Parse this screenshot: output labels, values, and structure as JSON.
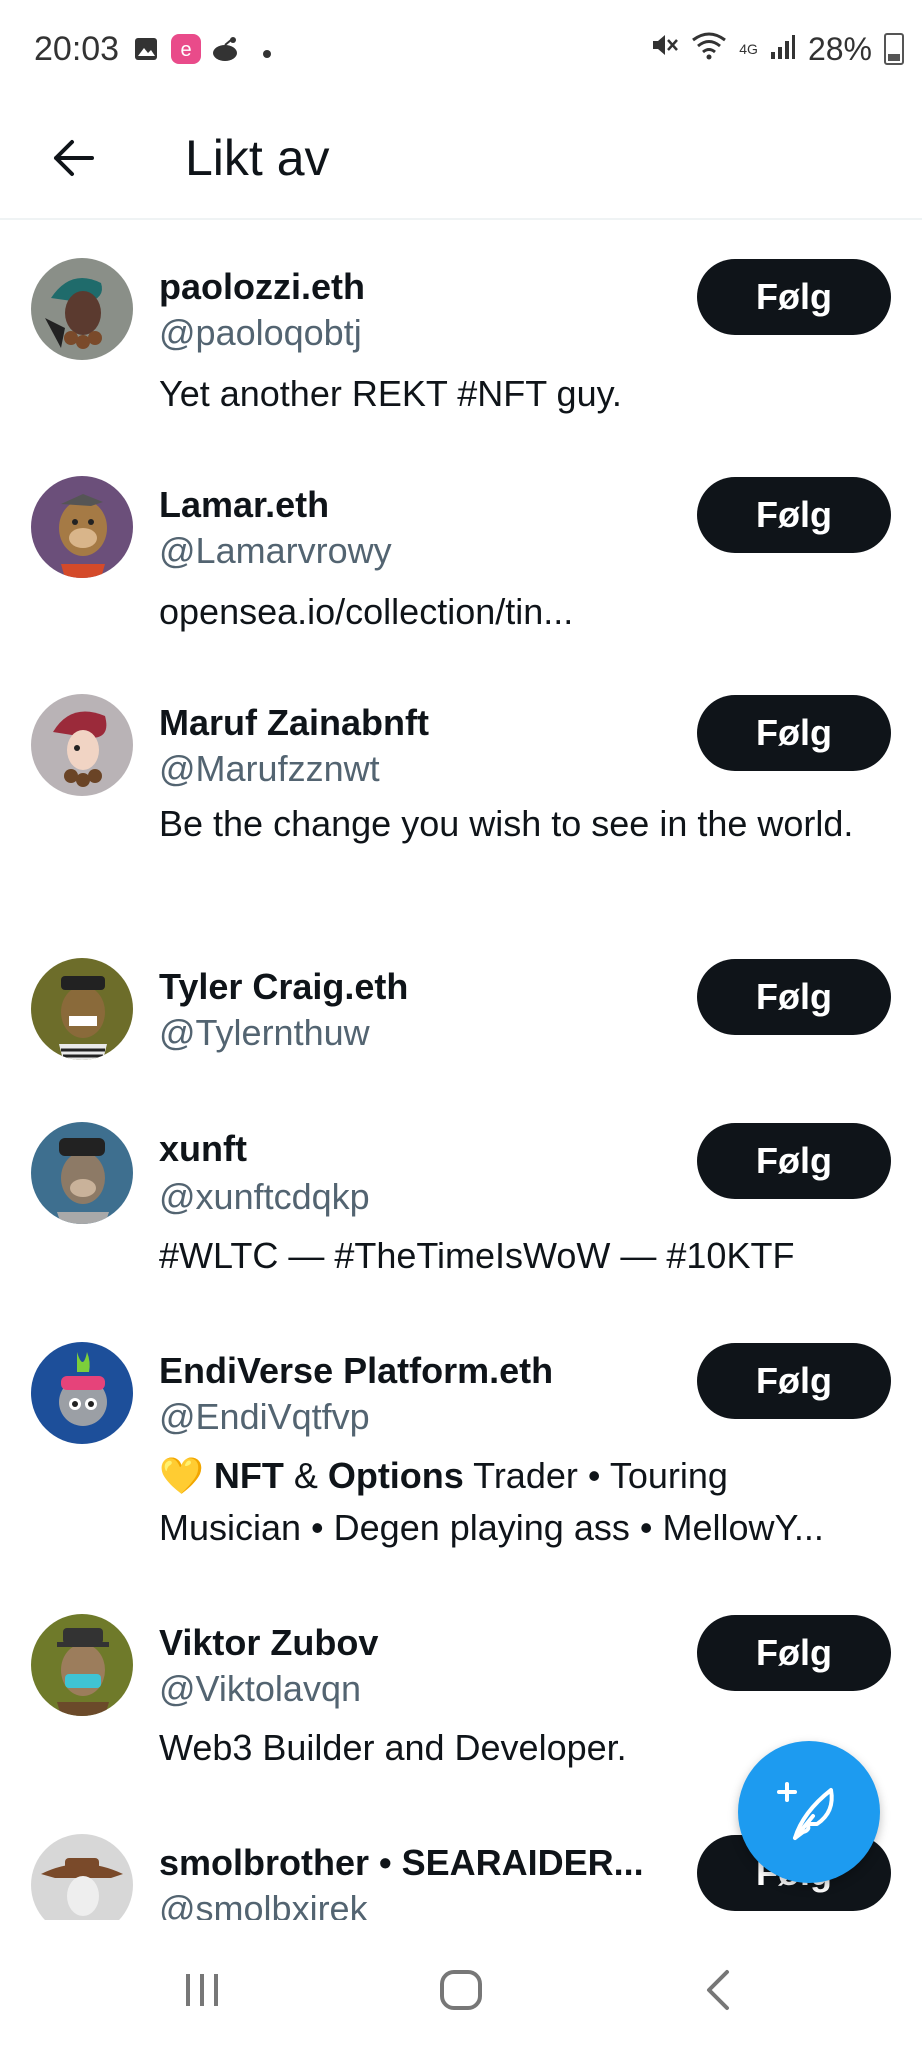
{
  "status_bar": {
    "time": "20:03",
    "network": "4G",
    "battery": "28%"
  },
  "header": {
    "title": "Likt av"
  },
  "users": [
    {
      "name": "paolozzi.eth",
      "handle": "@paoloqobtj",
      "bio": "Yet another REKT #NFT guy.",
      "follow_label": "Følg",
      "avatar_color": "#8a8f88"
    },
    {
      "name": "Lamar.eth",
      "handle": "@Lamarvrowy",
      "bio": "opensea.io/collection/tin...",
      "follow_label": "Følg",
      "avatar_color": "#6b4f7a"
    },
    {
      "name": "Maruf Zainabnft",
      "handle": "@Marufzznwt",
      "bio": "Be the change you wish to see in the world.",
      "follow_label": "Følg",
      "avatar_color": "#b9b3b6"
    },
    {
      "name": "Tyler Craig.eth",
      "handle": "@Tylernthuw",
      "bio": "",
      "follow_label": "Følg",
      "avatar_color": "#6d6d2a"
    },
    {
      "name": "xunft",
      "handle": "@xunftcdqkp",
      "bio": "#WLTC — #TheTimeIsWoW — #10KTF",
      "follow_label": "Følg",
      "avatar_color": "#3e6f8f"
    },
    {
      "name": "EndiVerse Platform.eth",
      "handle": "@EndiVqtfvp",
      "bio_parts": [
        "💛 ",
        "NFT",
        " & ",
        "Options",
        " Trader • Touring Musician • Degen playing ass • MellowY..."
      ],
      "follow_label": "Følg",
      "avatar_color": "#1d4f9a"
    },
    {
      "name": "Viktor Zubov",
      "handle": "@Viktolavqn",
      "bio": "Web3 Builder and Developer.",
      "follow_label": "Følg",
      "avatar_color": "#6f7a2a"
    },
    {
      "name": "smolbrother • SEARAIDER...",
      "handle": "@smolbxirek",
      "bio": "",
      "follow_label": "Følg",
      "avatar_color": "#d7d7d7"
    }
  ]
}
